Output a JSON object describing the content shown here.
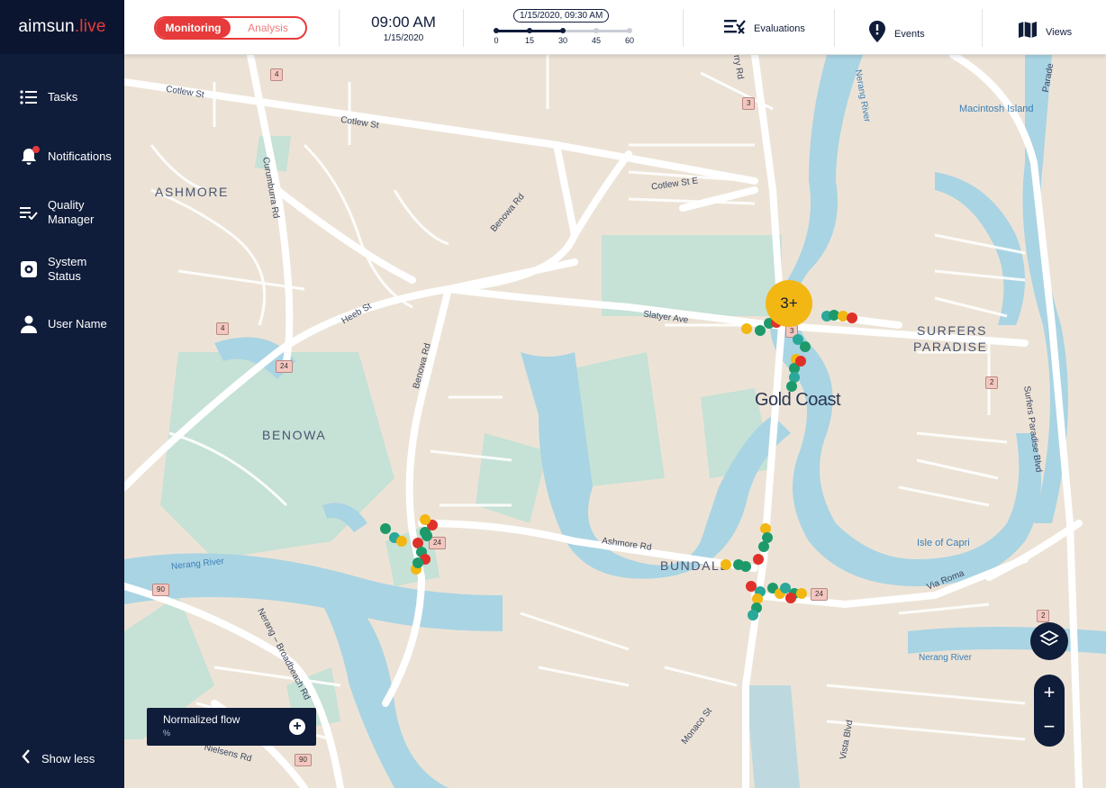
{
  "app": {
    "logo_main": "aimsun",
    "logo_dot": ".live"
  },
  "sidebar": {
    "items": [
      {
        "label": "Tasks",
        "icon": "list-icon"
      },
      {
        "label": "Notifications",
        "icon": "bell-icon"
      },
      {
        "label": "Quality\nManager",
        "icon": "checklist-icon"
      },
      {
        "label": "System\nStatus",
        "icon": "gear-icon"
      },
      {
        "label": "User Name",
        "icon": "user-icon"
      }
    ],
    "show_less": "Show less"
  },
  "topbar": {
    "mode_monitoring": "Monitoring",
    "mode_analysis": "Analysis",
    "clock_time": "09:00 AM",
    "clock_date": "1/15/2020",
    "timeline_bubble": "1/15/2020, 09:30 AM",
    "timeline_ticks": [
      "0",
      "15",
      "30",
      "45",
      "60"
    ],
    "timeline_selected_minutes": 30,
    "evaluations": "Evaluations",
    "events": "Events",
    "views": "Views"
  },
  "map": {
    "suburbs": [
      "ASHMORE",
      "BENOWA",
      "BUNDALL",
      "SURFERS",
      "PARADISE"
    ],
    "city": "Gold Coast",
    "streets": [
      "Cotlew St",
      "Cotlew St",
      "Cotlew St E",
      "Curumburra Rd",
      "Benowa Rd",
      "Benowa Rd",
      "Heeb St",
      "Slatyer Ave",
      "Ashmore Rd",
      "Via Roma",
      "Nerang – Broadbeach Rd",
      "Nielsens Rd",
      "Monaco St",
      "Surfers Paradise Blvd",
      "Surfers Paradise Blvd",
      "Vista Blvd",
      "Nerang River",
      "Nerang River",
      "Nerang River",
      "Isle of Capri",
      "Macintosh Island",
      "Parade",
      "rry Rd"
    ],
    "shields": [
      "4",
      "4",
      "24",
      "24",
      "24",
      "3",
      "3",
      "2",
      "2",
      "90",
      "90"
    ],
    "cluster_label": "3+"
  },
  "legend": {
    "title": "Normalized flow",
    "unit": "%",
    "add": "+"
  },
  "zoom": {
    "in": "+",
    "out": "−"
  },
  "colors": {
    "accent": "#e73a3a",
    "navy": "#0f1c3a",
    "water": "#a9d4e3",
    "park": "#c6e1d6",
    "road": "#ffffff",
    "land": "#ece3d6"
  }
}
